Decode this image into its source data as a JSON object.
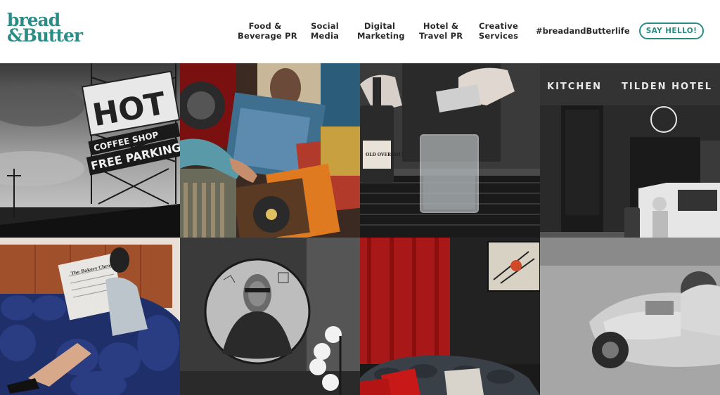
{
  "brand": {
    "logo_line1": "bread",
    "logo_line2": "&Butter",
    "accent_color": "#2b8c86"
  },
  "nav": {
    "items": [
      {
        "line1": "Food &",
        "line2": "Beverage PR"
      },
      {
        "line1": "Social",
        "line2": "Media"
      },
      {
        "line1": "Digital",
        "line2": "Marketing"
      },
      {
        "line1": "Hotel &",
        "line2": "Travel PR"
      },
      {
        "line1": "Creative",
        "line2": "Services"
      }
    ],
    "hashtag": "#breadandButterlife",
    "cta_label": "SAY HELLO!"
  },
  "gallery": {
    "tiles": [
      {
        "name": "hot-coffee-shop-sign",
        "sign_text_1": "HOT",
        "sign_text_2": "COFFEE SHOP",
        "sign_text_3": "FREE PARKING"
      },
      {
        "name": "record-crate-browsing"
      },
      {
        "name": "bartender-pouring-cocktail",
        "bottle_text": "OLD OVERHOLT"
      },
      {
        "name": "kitchen-tilden-hotel-facade",
        "sign_text_1": "KITCHEN",
        "sign_text_2": "TILDEN HOTEL"
      },
      {
        "name": "woman-reading-newspaper-sofa",
        "paper_text": "The Bakery Chronicle"
      },
      {
        "name": "mona-lisa-circle-art"
      },
      {
        "name": "red-velvet-lounge"
      },
      {
        "name": "scooter-rider-street"
      }
    ]
  }
}
